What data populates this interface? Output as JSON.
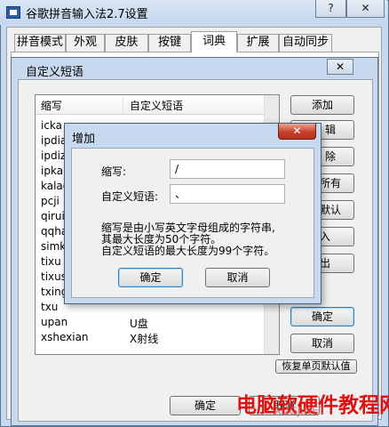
{
  "window": {
    "title": "谷歌拼音输入法2.7设置",
    "help_glyph": "?",
    "close_glyph": "✕"
  },
  "tabs": [
    {
      "label": "拼音模式",
      "active": false
    },
    {
      "label": "外观",
      "active": false
    },
    {
      "label": "皮肤",
      "active": false
    },
    {
      "label": "按键",
      "active": false
    },
    {
      "label": "词典",
      "active": true
    },
    {
      "label": "扩展",
      "active": false
    },
    {
      "label": "自动同步",
      "active": false
    }
  ],
  "phrase_dialog": {
    "title": "自定义短语",
    "close_glyph": "✕",
    "columns": {
      "abbr": "缩写",
      "phrase": "自定义短语"
    },
    "rows": [
      {
        "abbr": "icka",
        "phrase": ""
      },
      {
        "abbr": "ipdian",
        "phrase": ""
      },
      {
        "abbr": "ipdizhi",
        "phrase": ""
      },
      {
        "abbr": "ipka",
        "phrase": ""
      },
      {
        "abbr": "kalaok",
        "phrase": ""
      },
      {
        "abbr": "pcji",
        "phrase": ""
      },
      {
        "abbr": "qiruiqi",
        "phrase": ""
      },
      {
        "abbr": "qqhao",
        "phrase": ""
      },
      {
        "abbr": "simka",
        "phrase": ""
      },
      {
        "abbr": "tixu",
        "phrase": ""
      },
      {
        "abbr": "tixushan",
        "phrase": ""
      },
      {
        "abbr": "txing",
        "phrase": ""
      },
      {
        "abbr": "txu",
        "phrase": ""
      },
      {
        "abbr": "upan",
        "phrase": "U盘"
      },
      {
        "abbr": "xshexian",
        "phrase": "X射线"
      }
    ],
    "buttons": {
      "add": "添加",
      "ok": "确定",
      "cancel": "取消"
    },
    "side_buttons_partial": [
      "辑",
      "除",
      "所有",
      "默认",
      "入",
      "出"
    ]
  },
  "add_dialog": {
    "title": "增加",
    "close_glyph": "✕",
    "abbr_label": "缩写:",
    "abbr_value": "/",
    "phrase_label": "自定义短语:",
    "phrase_value": "、",
    "hint_lines": [
      "缩写是由小写英文字母组成的字符串,",
      "其最大长度为50个字符。",
      "自定义短语的最大长度为99个字符。"
    ],
    "ok_label": "确定",
    "cancel_label": "取消"
  },
  "bottom": {
    "ok_label": "确定",
    "cancel_label": "取消",
    "partial_button": "恢复单页默认值"
  },
  "watermark": {
    "text": "电脑软硬件教程网",
    "sub": "ADGJ.NET"
  },
  "colors": {
    "titlebar": "#c7d9ee",
    "close_red": "#c8412c",
    "watermark": "#e01010"
  }
}
